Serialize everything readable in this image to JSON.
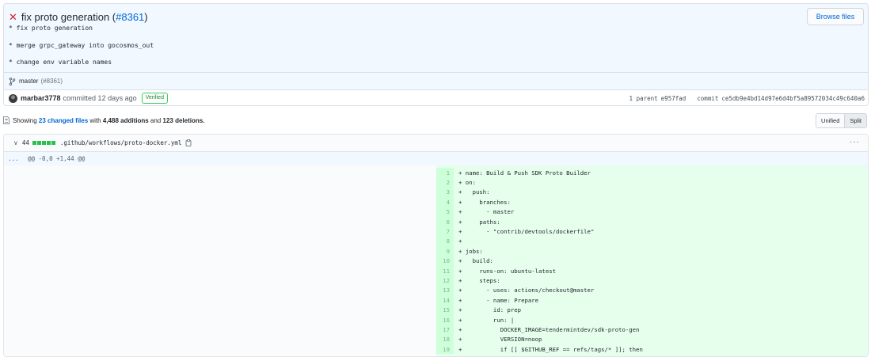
{
  "commit": {
    "status_icon": "x-icon",
    "title": "fix proto generation (",
    "pr_ref": "#8361",
    "title_end": ")",
    "browse_label": "Browse files",
    "body_lines": [
      "* fix proto generation",
      "* merge grpc_gateway into gocosmos_out",
      "* change env variable names"
    ],
    "branch": "master",
    "branch_pr": "(#8361)",
    "author": "marbar3778",
    "committed_text": "committed 12 days ago",
    "verified": "Verified",
    "parent_label": "1 parent",
    "parent_sha": "e957fad",
    "commit_label": "commit",
    "commit_sha": "ce5db9e4bd14d97e6d4bf5a89572034c49c640a6"
  },
  "toolbar": {
    "showing": "Showing",
    "changed_files": "23 changed files",
    "with": "with",
    "additions": "4,488 additions",
    "and": "and",
    "deletions": "123 deletions.",
    "unified": "Unified",
    "split": "Split"
  },
  "file": {
    "additions_count": "44",
    "path": ".github/workflows/proto-docker.yml",
    "hunk_expand": "...",
    "hunk_header": "@@ -0,0 +1,44 @@",
    "more": "···",
    "lines": [
      {
        "n": "1",
        "code": "+ name: Build & Push SDK Proto Builder"
      },
      {
        "n": "2",
        "code": "+ on:"
      },
      {
        "n": "3",
        "code": "+   push:"
      },
      {
        "n": "4",
        "code": "+     branches:"
      },
      {
        "n": "5",
        "code": "+       - master"
      },
      {
        "n": "6",
        "code": "+     paths:"
      },
      {
        "n": "7",
        "code": "+       - \"contrib/devtools/dockerfile\""
      },
      {
        "n": "8",
        "code": "+"
      },
      {
        "n": "9",
        "code": "+ jobs:"
      },
      {
        "n": "10",
        "code": "+   build:"
      },
      {
        "n": "11",
        "code": "+     runs-on: ubuntu-latest"
      },
      {
        "n": "12",
        "code": "+     steps:"
      },
      {
        "n": "13",
        "code": "+       - uses: actions/checkout@master"
      },
      {
        "n": "14",
        "code": "+       - name: Prepare"
      },
      {
        "n": "15",
        "code": "+         id: prep"
      },
      {
        "n": "16",
        "code": "+         run: |"
      },
      {
        "n": "17",
        "code": "+           DOCKER_IMAGE=tendermintdev/sdk-proto-gen"
      },
      {
        "n": "18",
        "code": "+           VERSION=noop"
      },
      {
        "n": "19",
        "code": "+           if [[ $GITHUB_REF == refs/tags/* ]]; then"
      }
    ]
  },
  "colors": {
    "addition_bg": "#e6ffed",
    "addition_num_bg": "#cdffd8",
    "link": "#0366d6",
    "error": "#cb2431"
  }
}
